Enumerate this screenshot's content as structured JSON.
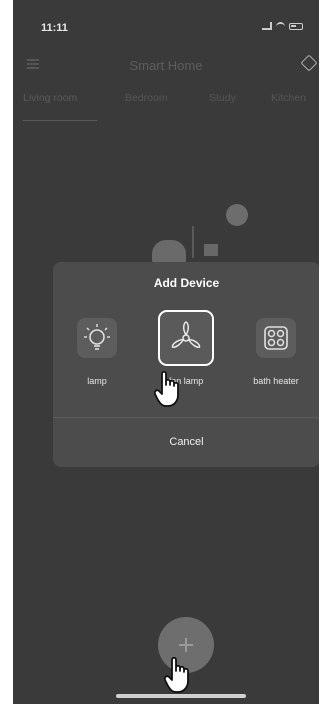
{
  "status_bar": {
    "time": "11:11"
  },
  "header": {
    "title": "Smart Home"
  },
  "tabs": [
    {
      "label": "Living room",
      "active": true
    },
    {
      "label": "Bedroom",
      "active": false
    },
    {
      "label": "Study",
      "active": false
    },
    {
      "label": "Kitchen",
      "active": false
    }
  ],
  "dialog": {
    "title": "Add Device",
    "devices": [
      {
        "label": "lamp",
        "icon": "lightbulb-icon",
        "selected": false
      },
      {
        "label": "fan lamp",
        "icon": "fan-icon",
        "selected": true
      },
      {
        "label": "bath heater",
        "icon": "heater-icon",
        "selected": false
      }
    ],
    "cancel_label": "Cancel"
  },
  "fab": {
    "icon": "plus-icon"
  },
  "colors": {
    "background": "#3a3a3a",
    "dialog": "#4c4c4c",
    "accent": "#ffffff"
  }
}
